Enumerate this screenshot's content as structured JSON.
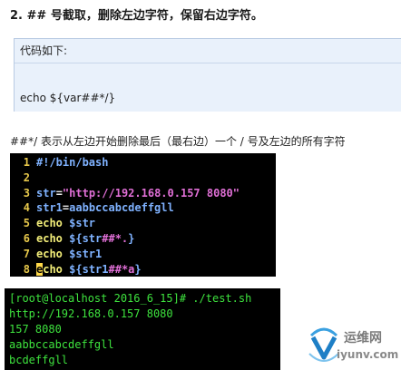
{
  "heading": "2. ## 号截取，删除左边字符，保留右边字符。",
  "code_box": {
    "header": "代码如下:",
    "code": "echo ${var##*/}"
  },
  "explanation": "##*/ 表示从左边开始删除最后（最右边）一个 / 号及左边的所有字符",
  "editor": {
    "lines": [
      {
        "num": "1",
        "tokens": [
          {
            "cls": "tk-shebang",
            "text": "#!/bin/bash"
          }
        ]
      },
      {
        "num": "2",
        "tokens": []
      },
      {
        "num": "3",
        "tokens": [
          {
            "cls": "tk-var",
            "text": "str"
          },
          {
            "cls": "tk-eq",
            "text": "="
          },
          {
            "cls": "tk-str",
            "text": "\"http://192.168.0.157 8080\""
          }
        ]
      },
      {
        "num": "4",
        "tokens": [
          {
            "cls": "tk-var",
            "text": "str1"
          },
          {
            "cls": "tk-eq",
            "text": "="
          },
          {
            "cls": "tk-val",
            "text": "aabbccabcdeffgll"
          }
        ]
      },
      {
        "num": "5",
        "tokens": [
          {
            "cls": "tk-kw",
            "text": "echo "
          },
          {
            "cls": "tk-param",
            "text": "$str"
          }
        ]
      },
      {
        "num": "6",
        "tokens": [
          {
            "cls": "tk-kw",
            "text": "echo "
          },
          {
            "cls": "tk-param",
            "text": "${str"
          },
          {
            "cls": "tk-op",
            "text": "##*."
          },
          {
            "cls": "tk-param",
            "text": "}"
          }
        ]
      },
      {
        "num": "7",
        "tokens": [
          {
            "cls": "tk-kw",
            "text": "echo "
          },
          {
            "cls": "tk-param",
            "text": "$str1"
          }
        ]
      },
      {
        "num": "8",
        "tokens": [
          {
            "cls": "tk-kw cursor",
            "text": "e"
          },
          {
            "cls": "tk-kw",
            "text": "cho "
          },
          {
            "cls": "tk-param",
            "text": "${str1"
          },
          {
            "cls": "tk-op",
            "text": "##*a"
          },
          {
            "cls": "tk-param",
            "text": "}"
          }
        ]
      }
    ]
  },
  "terminal": {
    "lines": [
      "[root@localhost 2016_6_15]# ./test.sh",
      "http://192.168.0.157 8080",
      "157 8080",
      "aabbccabcdeffgll",
      "bcdeffgll"
    ]
  },
  "watermark": {
    "name": "运维网",
    "url": "iyunv.com"
  }
}
